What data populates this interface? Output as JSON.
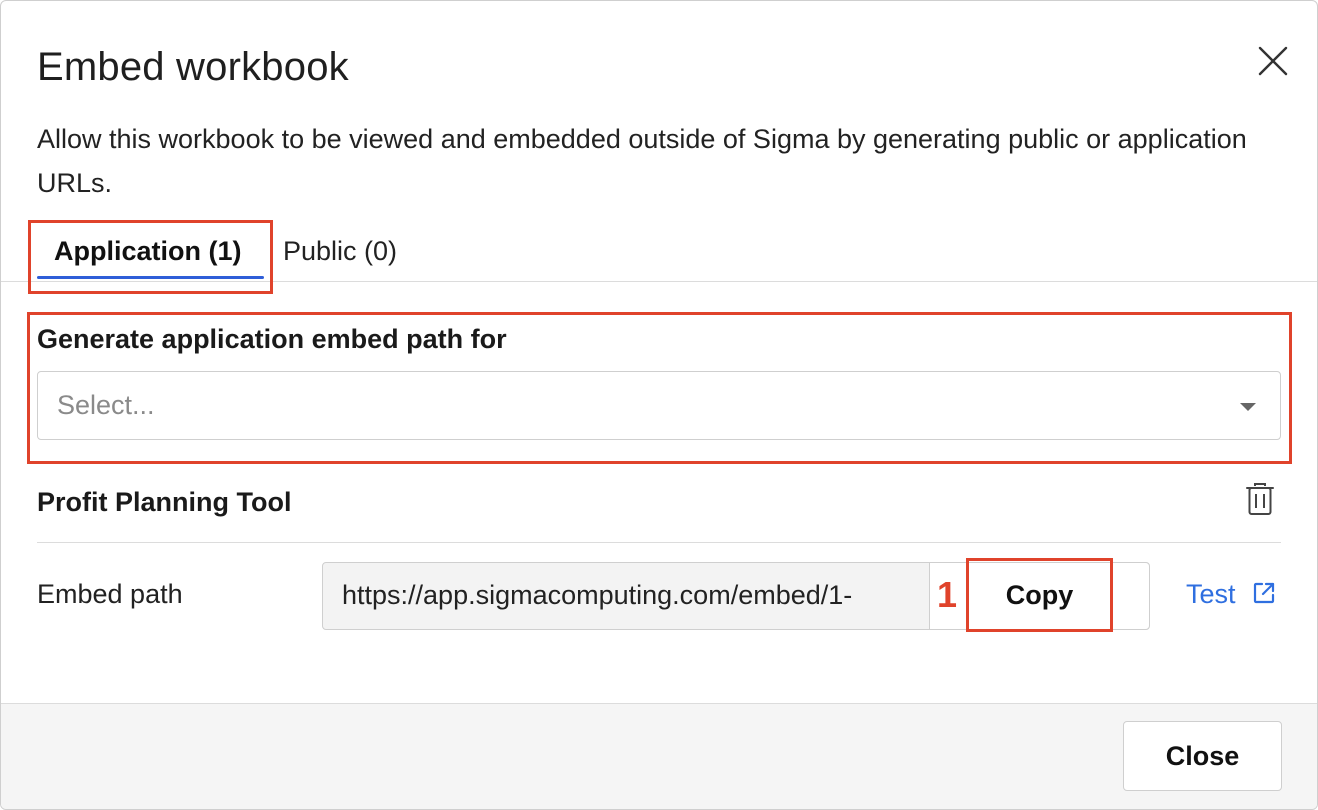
{
  "dialog": {
    "title": "Embed workbook",
    "description": "Allow this workbook to be viewed and embedded outside of Sigma by generating public or application URLs."
  },
  "tabs": [
    {
      "label": "Application (1)",
      "active": true
    },
    {
      "label": "Public (0)",
      "active": false
    }
  ],
  "generate": {
    "label": "Generate application embed path for",
    "placeholder": "Select..."
  },
  "embed_item": {
    "title": "Profit Planning Tool",
    "path_label": "Embed path",
    "url": "https://app.sigmacomputing.com/embed/1-",
    "copy_label": "Copy",
    "test_label": "Test"
  },
  "annotation": {
    "step_number": "1",
    "color": "#e0432b"
  },
  "footer": {
    "close_label": "Close"
  },
  "colors": {
    "accent": "#2f5ed8",
    "link": "#2f6fe0",
    "highlight": "#e0432b"
  },
  "icons": [
    "close-icon",
    "chevron-down-icon",
    "trash-icon",
    "external-link-icon"
  ]
}
